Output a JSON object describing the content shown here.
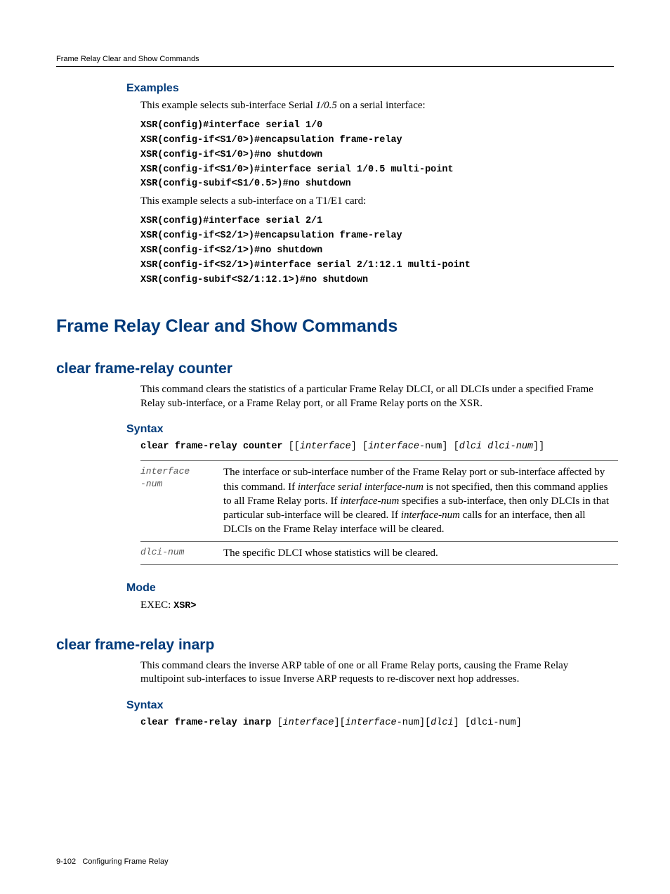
{
  "running_head": "Frame Relay Clear and Show Commands",
  "examples": {
    "heading": "Examples",
    "intro1_pre": "This example selects sub-interface Serial ",
    "intro1_em": "1/0.5",
    "intro1_post": " on a serial interface:",
    "code1": "XSR(config)#interface serial 1/0\nXSR(config-if<S1/0>)#encapsulation frame-relay\nXSR(config-if<S1/0>)#no shutdown\nXSR(config-if<S1/0>)#interface serial 1/0.5 multi-point\nXSR(config-subif<S1/0.5>)#no shutdown",
    "intro2": "This example selects a sub-interface on a T1/E1 card:",
    "code2": "XSR(config)#interface serial 2/1\nXSR(config-if<S2/1>)#encapsulation frame-relay\nXSR(config-if<S2/1>)#no shutdown\nXSR(config-if<S2/1>)#interface serial 2/1:12.1 multi-point\nXSR(config-subif<S2/1:12.1>)#no shutdown"
  },
  "h1": "Frame Relay Clear and Show Commands",
  "counter": {
    "heading": "clear frame-relay counter",
    "desc": "This command clears the statistics of a particular Frame Relay DLCI, or all DLCIs under a specified Frame Relay sub-interface, or a Frame Relay port, or all Frame Relay ports on the XSR.",
    "syntax_heading": "Syntax",
    "syntax_cmd": "clear frame-relay counter ",
    "syntax_rest_1": "[[",
    "syntax_rest_2": "interface",
    "syntax_rest_3": "] [",
    "syntax_rest_4": "interface-",
    "syntax_rest_5": "num] [",
    "syntax_rest_6": "dlci dlci-num",
    "syntax_rest_7": "]]",
    "params": [
      {
        "key": "interface\n-num",
        "val_1": "The interface or sub-interface number of the Frame Relay port or sub-interface affected by this command. If ",
        "val_2": "interface serial interface-num",
        "val_3": " is not specified, then this command applies to all Frame Relay ports. If ",
        "val_4": "interface-num",
        "val_5": " specifies a sub-interface, then only DLCIs in that particular sub-interface will be cleared. If ",
        "val_6": "interface-num",
        "val_7": " calls for an interface, then all DLCIs on the Frame Relay interface will be cleared."
      },
      {
        "key": "dlci-num",
        "val_1": "The specific DLCI whose statistics will be cleared."
      }
    ],
    "mode_heading": "Mode",
    "mode_pre": "EXEC: ",
    "mode_code": "XSR>"
  },
  "inarp": {
    "heading": "clear frame-relay inarp",
    "desc": "This command clears the inverse ARP table of one or all Frame Relay ports, causing the Frame Relay multipoint sub-interfaces to issue Inverse ARP requests to re-discover next hop addresses.",
    "syntax_heading": "Syntax",
    "syntax_cmd": "clear frame-relay inarp ",
    "s1": "[",
    "s2": "interface",
    "s3": "][",
    "s4": "interface-",
    "s5": "num][",
    "s6": "dlci",
    "s7": "]",
    "s8": " [dlci-num]"
  },
  "footer": {
    "page": "9-102",
    "title": "Configuring Frame Relay"
  }
}
